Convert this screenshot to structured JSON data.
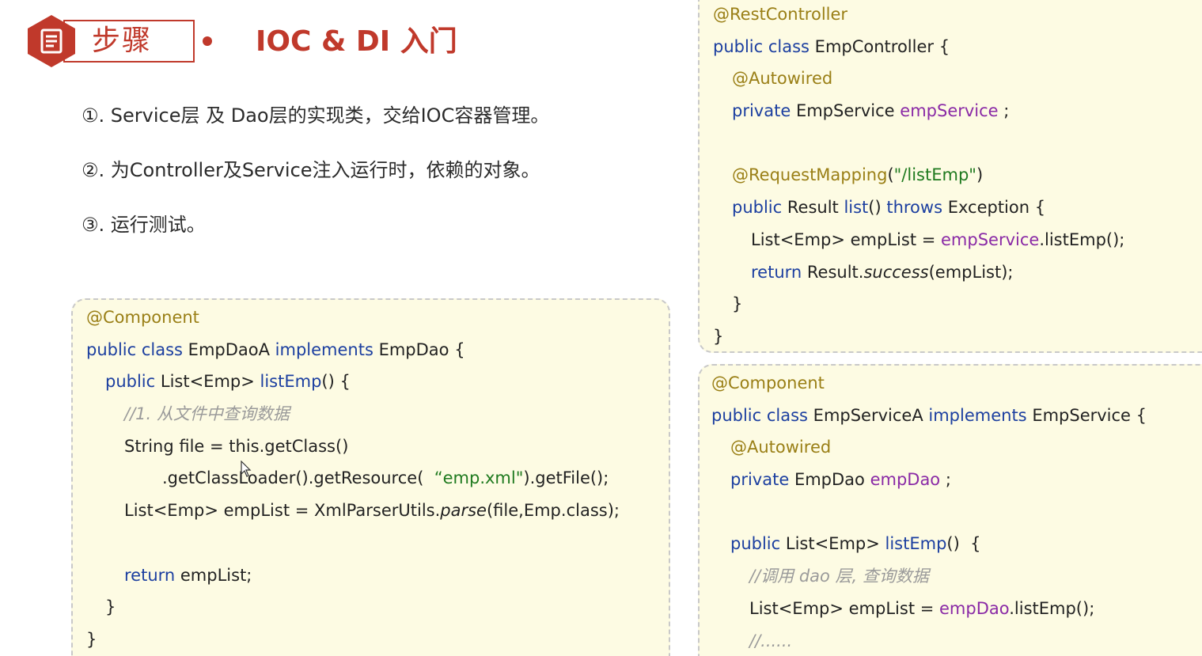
{
  "header": {
    "badge_label": "步骤",
    "badge_icon": "document-icon",
    "title": "IOC & DI 入门",
    "accent_color": "#c0392b"
  },
  "steps": [
    "①. Service层 及 Dao层的实现类，交给IOC容器管理。",
    "②. 为Controller及Service注入运行时，依赖的对象。",
    "③. 运行测试。"
  ],
  "code_dao": {
    "lines": [
      {
        "indent": 0,
        "tokens": [
          {
            "t": "@Component",
            "c": "ann"
          }
        ]
      },
      {
        "indent": 0,
        "tokens": [
          {
            "t": "public class ",
            "c": "kw"
          },
          {
            "t": "EmpDaoA ",
            "c": ""
          },
          {
            "t": "implements ",
            "c": "kw"
          },
          {
            "t": "EmpDao {",
            "c": ""
          }
        ]
      },
      {
        "indent": 1,
        "tokens": [
          {
            "t": "public ",
            "c": "kw"
          },
          {
            "t": "List<Emp> ",
            "c": ""
          },
          {
            "t": "listEmp",
            "c": "kw"
          },
          {
            "t": "() {",
            "c": ""
          }
        ]
      },
      {
        "indent": 2,
        "tokens": [
          {
            "t": "//1. 从文件中查询数据",
            "c": "cmt"
          }
        ]
      },
      {
        "indent": 2,
        "tokens": [
          {
            "t": "String file = this.getClass()",
            "c": ""
          }
        ]
      },
      {
        "indent": 4,
        "tokens": [
          {
            "t": ".getClassLoader().getResource(  ",
            "c": ""
          },
          {
            "t": "“emp.xml\"",
            "c": "str"
          },
          {
            "t": ").getFile();",
            "c": ""
          }
        ]
      },
      {
        "indent": 2,
        "tokens": [
          {
            "t": "List<Emp> empList = XmlParserUtils.",
            "c": ""
          },
          {
            "t": "parse",
            "c": "it"
          },
          {
            "t": "(file,Emp.class);",
            "c": ""
          }
        ]
      },
      {
        "indent": 0,
        "tokens": []
      },
      {
        "indent": 2,
        "tokens": [
          {
            "t": "return ",
            "c": "kw"
          },
          {
            "t": "empList;",
            "c": ""
          }
        ]
      },
      {
        "indent": 1,
        "tokens": [
          {
            "t": "}",
            "c": ""
          }
        ]
      },
      {
        "indent": 0,
        "tokens": [
          {
            "t": "}",
            "c": ""
          }
        ]
      }
    ]
  },
  "code_controller": {
    "lines": [
      {
        "indent": 0,
        "tokens": [
          {
            "t": "@RestController",
            "c": "ann"
          }
        ]
      },
      {
        "indent": 0,
        "tokens": [
          {
            "t": "public class ",
            "c": "kw"
          },
          {
            "t": "EmpController {",
            "c": ""
          }
        ]
      },
      {
        "indent": 1,
        "tokens": [
          {
            "t": "@Autowired",
            "c": "ann"
          }
        ]
      },
      {
        "indent": 1,
        "tokens": [
          {
            "t": "private ",
            "c": "kw"
          },
          {
            "t": "EmpService ",
            "c": ""
          },
          {
            "t": "empService",
            "c": "fld"
          },
          {
            "t": " ;",
            "c": ""
          }
        ]
      },
      {
        "indent": 0,
        "tokens": []
      },
      {
        "indent": 1,
        "tokens": [
          {
            "t": "@RequestMapping",
            "c": "ann"
          },
          {
            "t": "(",
            "c": ""
          },
          {
            "t": "\"/listEmp\"",
            "c": "str"
          },
          {
            "t": ")",
            "c": ""
          }
        ]
      },
      {
        "indent": 1,
        "tokens": [
          {
            "t": "public ",
            "c": "kw"
          },
          {
            "t": "Result ",
            "c": ""
          },
          {
            "t": "list",
            "c": "kw"
          },
          {
            "t": "() ",
            "c": ""
          },
          {
            "t": "throws ",
            "c": "kw"
          },
          {
            "t": "Exception {",
            "c": ""
          }
        ]
      },
      {
        "indent": 2,
        "tokens": [
          {
            "t": "List<Emp> empList = ",
            "c": ""
          },
          {
            "t": "empService",
            "c": "fld"
          },
          {
            "t": ".listEmp();",
            "c": ""
          }
        ]
      },
      {
        "indent": 2,
        "tokens": [
          {
            "t": "return ",
            "c": "kw"
          },
          {
            "t": "Result.",
            "c": ""
          },
          {
            "t": "success",
            "c": "it"
          },
          {
            "t": "(empList);",
            "c": ""
          }
        ]
      },
      {
        "indent": 1,
        "tokens": [
          {
            "t": "}",
            "c": ""
          }
        ]
      },
      {
        "indent": 0,
        "tokens": [
          {
            "t": "}",
            "c": ""
          }
        ]
      }
    ]
  },
  "code_service": {
    "lines": [
      {
        "indent": 0,
        "tokens": [
          {
            "t": "@Component",
            "c": "ann"
          }
        ]
      },
      {
        "indent": 0,
        "tokens": [
          {
            "t": "public class ",
            "c": "kw"
          },
          {
            "t": "EmpServiceA ",
            "c": ""
          },
          {
            "t": "implements ",
            "c": "kw"
          },
          {
            "t": "EmpService {",
            "c": ""
          }
        ]
      },
      {
        "indent": 1,
        "tokens": [
          {
            "t": "@Autowired",
            "c": "ann"
          }
        ]
      },
      {
        "indent": 1,
        "tokens": [
          {
            "t": "private ",
            "c": "kw"
          },
          {
            "t": "EmpDao ",
            "c": ""
          },
          {
            "t": "empDao",
            "c": "fld"
          },
          {
            "t": " ;",
            "c": ""
          }
        ]
      },
      {
        "indent": 0,
        "tokens": []
      },
      {
        "indent": 1,
        "tokens": [
          {
            "t": "public ",
            "c": "kw"
          },
          {
            "t": "List<Emp> ",
            "c": ""
          },
          {
            "t": "listEmp",
            "c": "kw"
          },
          {
            "t": "()  {",
            "c": ""
          }
        ]
      },
      {
        "indent": 2,
        "tokens": [
          {
            "t": "//调用 dao 层, 查询数据",
            "c": "cmt"
          }
        ]
      },
      {
        "indent": 2,
        "tokens": [
          {
            "t": "List<Emp> empList = ",
            "c": ""
          },
          {
            "t": "empDao",
            "c": "fld"
          },
          {
            "t": ".listEmp();",
            "c": ""
          }
        ]
      },
      {
        "indent": 2,
        "tokens": [
          {
            "t": "//......",
            "c": "cmt"
          }
        ]
      }
    ]
  }
}
